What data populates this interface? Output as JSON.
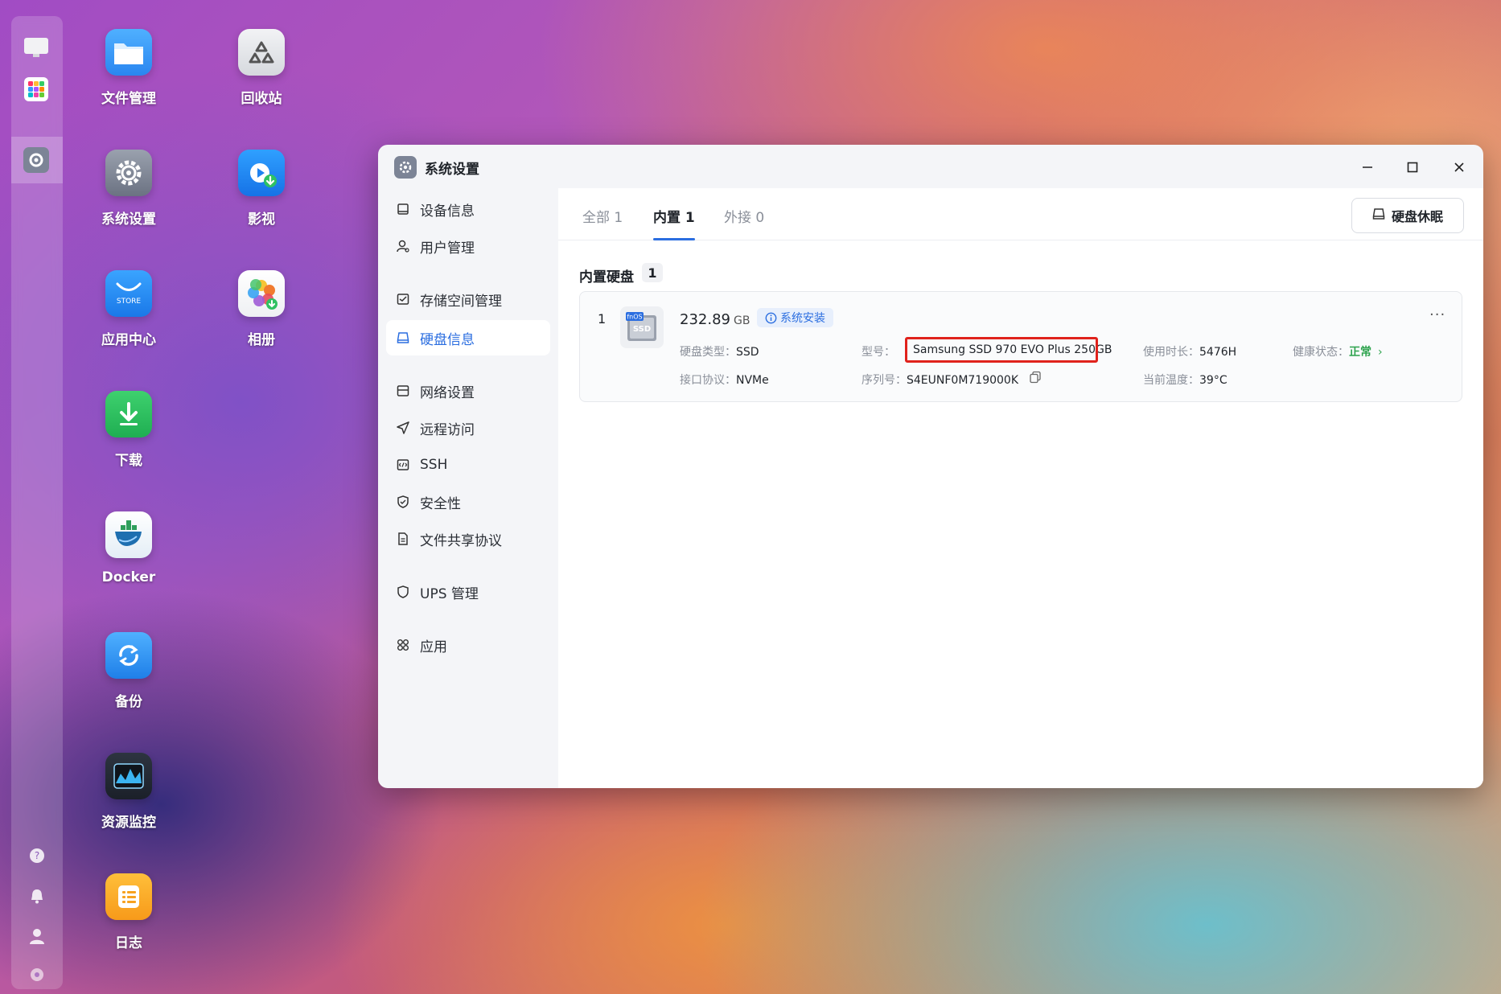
{
  "desktop": {
    "icons": [
      {
        "label": "文件管理",
        "icon": "folder-icon"
      },
      {
        "label": "回收站",
        "icon": "recycle-bin-icon"
      },
      {
        "label": "系统设置",
        "icon": "gear-icon"
      },
      {
        "label": "影视",
        "icon": "video-icon"
      },
      {
        "label": "应用中心",
        "icon": "store-icon",
        "tile_text": "STORE"
      },
      {
        "label": "相册",
        "icon": "photos-icon"
      },
      {
        "label": "下载",
        "icon": "download-icon"
      },
      {
        "label": "Docker",
        "icon": "docker-icon"
      },
      {
        "label": "备份",
        "icon": "backup-icon"
      },
      {
        "label": "资源监控",
        "icon": "monitor-icon"
      },
      {
        "label": "日志",
        "icon": "log-icon"
      }
    ]
  },
  "window": {
    "title": "系统设置",
    "controls": {
      "minimize": "—",
      "maximize": "☐",
      "close": "✕"
    }
  },
  "sidebar": {
    "items": [
      {
        "label": "设备信息",
        "icon": "device-icon"
      },
      {
        "label": "用户管理",
        "icon": "user-icon"
      },
      {
        "label": "存储空间管理",
        "icon": "storage-icon"
      },
      {
        "label": "硬盘信息",
        "icon": "disk-icon",
        "active": true
      },
      {
        "label": "网络设置",
        "icon": "network-icon"
      },
      {
        "label": "远程访问",
        "icon": "remote-icon"
      },
      {
        "label": "SSH",
        "icon": "ssh-icon"
      },
      {
        "label": "安全性",
        "icon": "shield-icon"
      },
      {
        "label": "文件共享协议",
        "icon": "file-share-icon"
      },
      {
        "label": "UPS 管理",
        "icon": "ups-icon"
      },
      {
        "label": "应用",
        "icon": "apps-icon"
      }
    ]
  },
  "tabs": [
    {
      "label": "全部 1",
      "active": false
    },
    {
      "label": "内置 1",
      "active": true
    },
    {
      "label": "外接 0",
      "active": false
    }
  ],
  "sleep_button": "硬盘休眠",
  "section": {
    "title": "内置硬盘",
    "count": "1"
  },
  "disk": {
    "index": "1",
    "image_badge": "fnOS",
    "image_text": "SSD",
    "capacity": "232.89",
    "capacity_unit": "GB",
    "system_badge": "系统安装",
    "type_label": "硬盘类型：",
    "type_value": "SSD",
    "model_label": "型号：",
    "model_value": "Samsung SSD 970 EVO Plus 250GB",
    "usage_label": "使用时长：",
    "usage_value": "5476H",
    "health_label": "健康状态：",
    "health_value": "正常",
    "interface_label": "接口协议：",
    "interface_value": "NVMe",
    "serial_label": "序列号：",
    "serial_value": "S4EUNF0M719000K",
    "temp_label": "当前温度：",
    "temp_value": "39°C",
    "more": "···"
  },
  "colors": {
    "accent": "#2b6ee0",
    "healthy": "#2fa44f",
    "highlight": "#e0221c"
  }
}
